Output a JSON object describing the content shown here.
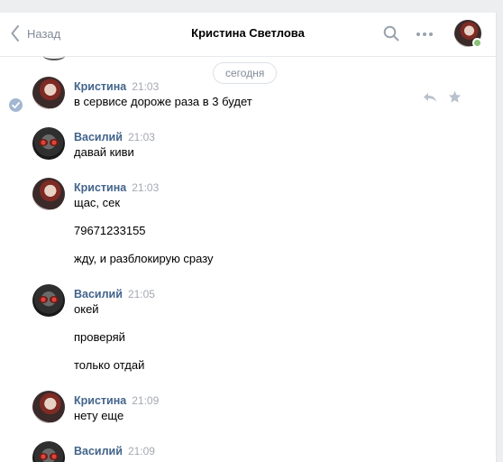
{
  "header": {
    "back_label": "Назад",
    "title": "Кристина Светлова"
  },
  "date_divider": "сегодня",
  "messages": [
    {
      "author": "Кристина",
      "time": "21:03",
      "lines": [
        "в сервисе дороже раза в 3 будет"
      ]
    },
    {
      "author": "Василий",
      "time": "21:03",
      "lines": [
        "давай киви"
      ]
    },
    {
      "author": "Кристина",
      "time": "21:03",
      "lines": [
        "щас, сек",
        "79671233155",
        "жду, и разблокирую сразу"
      ]
    },
    {
      "author": "Василий",
      "time": "21:05",
      "lines": [
        "окей",
        "проверяй",
        "только отдай"
      ]
    },
    {
      "author": "Кристина",
      "time": "21:09",
      "lines": [
        "нету еще"
      ]
    },
    {
      "author": "Василий",
      "time": "21:09",
      "lines": []
    }
  ],
  "colors": {
    "author": "#42648b",
    "time": "#a4a9b0",
    "accent": "#4a76a8"
  },
  "icons": [
    "chevron-left-icon",
    "search-icon",
    "more-icon",
    "check-icon",
    "reply-icon",
    "star-icon"
  ]
}
